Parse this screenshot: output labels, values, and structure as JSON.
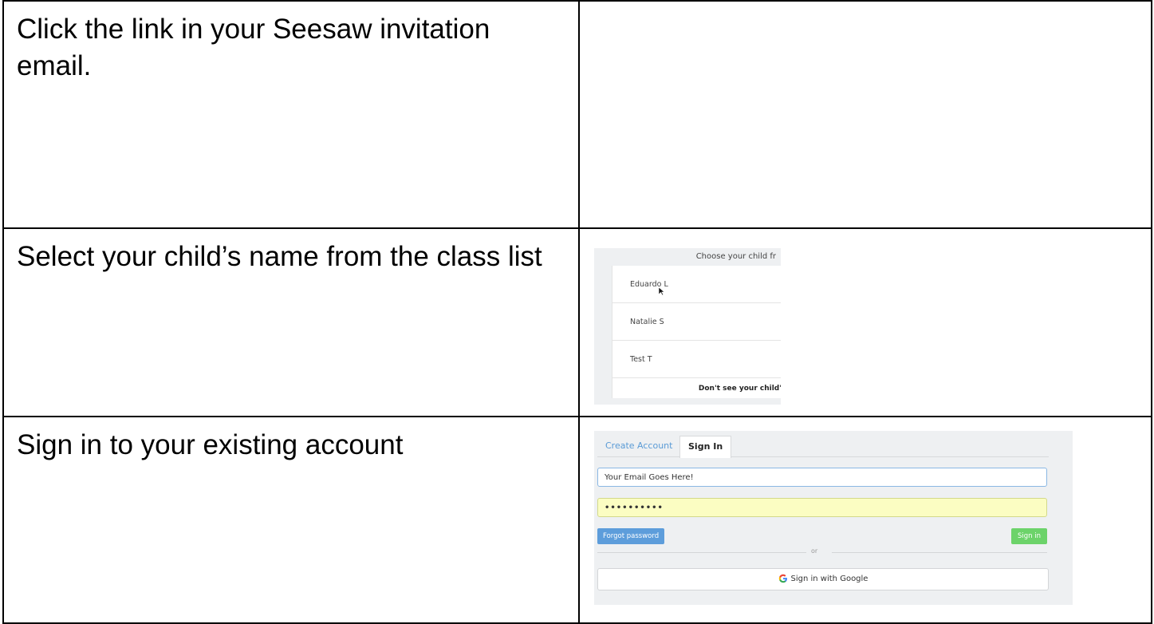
{
  "rows": [
    {
      "step": "Click the link in your Seesaw invitation email."
    },
    {
      "step": "Select your child’s name from the class list"
    },
    {
      "step": "Sign in to your existing account"
    }
  ],
  "class_list": {
    "heading": "Choose your child fr",
    "students": [
      "Eduardo L",
      "Natalie S",
      "Test T"
    ],
    "footer": "Don't see your child'"
  },
  "sign_in": {
    "tabs": [
      "Create Account",
      "Sign In"
    ],
    "email_value": "Your Email Goes Here!",
    "password_value": "••••••••••",
    "forgot_label": "Forgot password",
    "signin_label": "Sign in",
    "or_label": "or",
    "google_label": "Sign in with Google"
  }
}
